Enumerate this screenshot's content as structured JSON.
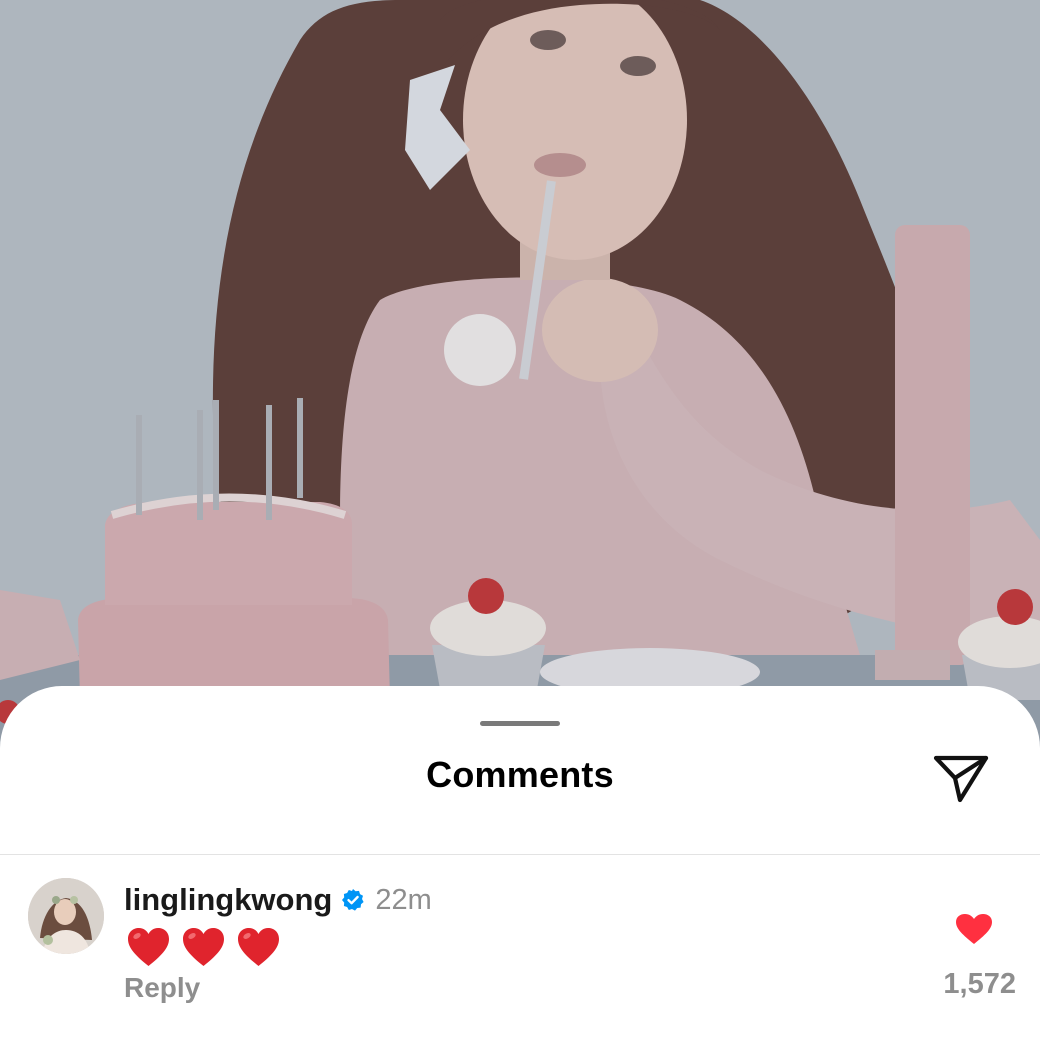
{
  "post_photo": {
    "icon": "post-photo",
    "overlay_color": "#9aa3ad"
  },
  "comments_sheet": {
    "title": "Comments",
    "share_icon": "paper-plane-icon"
  },
  "comments": [
    {
      "username": "linglingkwong",
      "verified": true,
      "timestamp": "22m",
      "text": "❤️❤️❤️",
      "reply_label": "Reply",
      "like_count": "1,572",
      "liked": true
    }
  ],
  "colors": {
    "verified_badge": "#0095f6",
    "like_heart": "#ff3040",
    "emoji_heart": "#e0242d",
    "secondary_text": "#8e8e8e"
  }
}
